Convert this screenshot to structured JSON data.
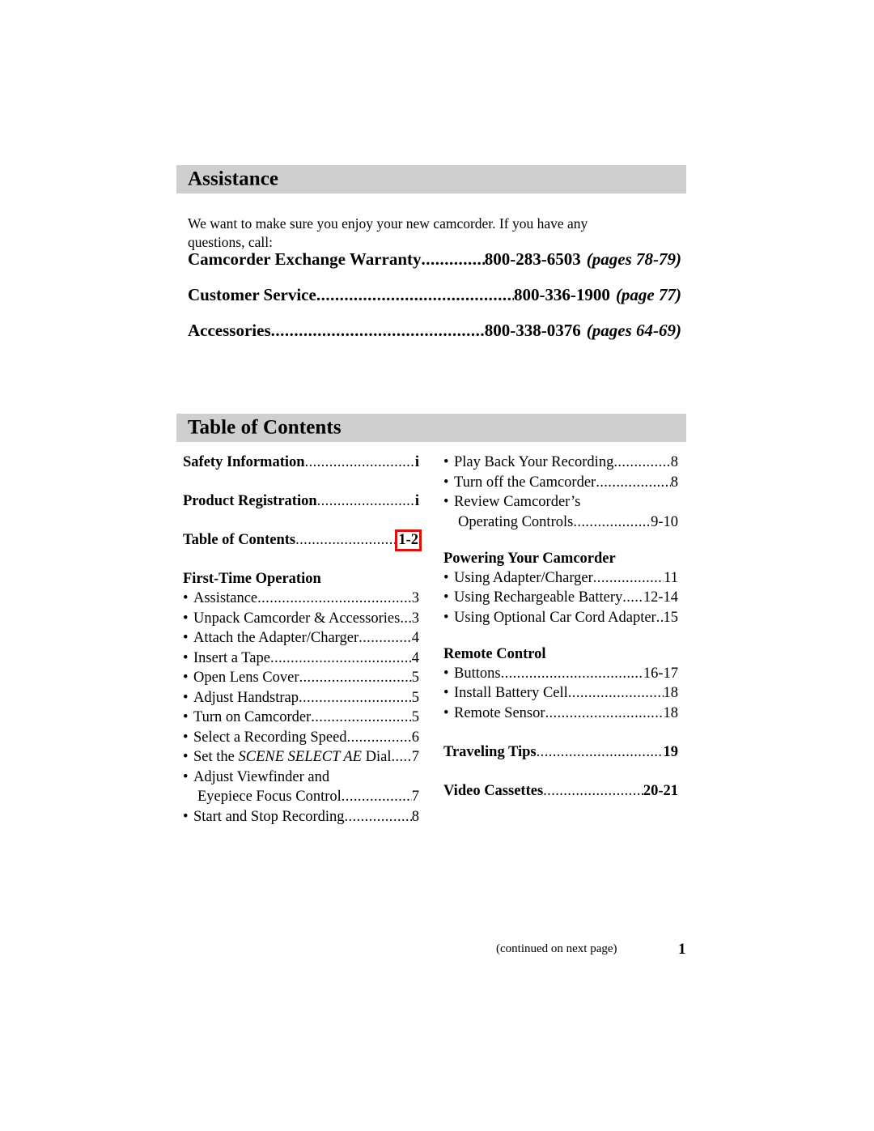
{
  "assistance": {
    "heading": "Assistance",
    "intro": "We want to make sure you enjoy your new camcorder. If you have any questions, call:",
    "contacts": [
      {
        "label": "Camcorder Exchange Warranty",
        "dots": "............................................................",
        "number": "800-283-6503",
        "pages": "(pages 78-79)"
      },
      {
        "label": "Customer Service",
        "dots": "............................................................",
        "number": "800-336-1900",
        "pages": "(page 77)"
      },
      {
        "label": "Accessories",
        "dots": "............................................................",
        "number": "800-338-0376",
        "pages": "(pages 64-69)"
      }
    ]
  },
  "toc": {
    "heading": "Table of Contents",
    "left_column": {
      "major_entries": [
        {
          "label": "Safety Information",
          "dots": "..........................................................",
          "page": "i",
          "highlighted": false
        },
        {
          "label": "Product Registration",
          "dots": "..........................................................",
          "page": "i",
          "highlighted": false
        },
        {
          "label": "Table of Contents",
          "dots": "..........................................................",
          "page": "1-2",
          "highlighted": true
        }
      ],
      "group_title": "First-Time Operation",
      "items": [
        {
          "bullet": "•",
          "label": "Assistance",
          "dots": "..................................................................",
          "page": "3",
          "continuation": false
        },
        {
          "bullet": "•",
          "label": "Unpack Camcorder & Accessories",
          "dots": "....",
          "page": "3",
          "continuation": false
        },
        {
          "bullet": "•",
          "label": "Attach the Adapter/Charger",
          "dots": "..................................................................",
          "page": "4",
          "continuation": false
        },
        {
          "bullet": "•",
          "label": "Insert a Tape",
          "dots": "..................................................................",
          "page": "4",
          "continuation": false
        },
        {
          "bullet": "•",
          "label": "Open Lens Cover",
          "dots": "..................................................................",
          "page": "5",
          "continuation": false
        },
        {
          "bullet": "•",
          "label": "Adjust Handstrap",
          "dots": "..................................................................",
          "page": "5",
          "continuation": false
        },
        {
          "bullet": "•",
          "label": "Turn on Camcorder",
          "dots": "..................................................................",
          "page": "5",
          "continuation": false
        },
        {
          "bullet": "•",
          "label": "Select a Recording Speed",
          "dots": "..................................................................",
          "page": "6",
          "continuation": false
        },
        {
          "bullet": "•",
          "label_pre": "Set the ",
          "label_em": "SCENE SELECT AE",
          "label_post": " Dial",
          "dots": "......",
          "page": "7",
          "continuation": false
        },
        {
          "bullet": "•",
          "label": "Adjust Viewfinder and",
          "dots": "",
          "page": "",
          "continuation": false
        },
        {
          "bullet": "•",
          "label": "Eyepiece Focus Control",
          "dots": "..................................................................",
          "page": "7",
          "continuation": true
        },
        {
          "bullet": "•",
          "label": "Start and Stop Recording",
          "dots": "..................................................................",
          "page": "8",
          "continuation": false
        }
      ]
    },
    "right_column": {
      "items_top": [
        {
          "bullet": "•",
          "label": "Play Back Your Recording",
          "dots": "..................................................................",
          "page": "8",
          "continuation": false
        },
        {
          "bullet": "•",
          "label": "Turn off the Camcorder",
          "dots": "..................................................................",
          "page": "8",
          "continuation": false
        },
        {
          "bullet": "•",
          "label": "Review Camcorder’s",
          "dots": "",
          "page": "",
          "continuation": false
        },
        {
          "bullet": "•",
          "label": "Operating Controls",
          "dots": "..................................................................",
          "page": "9-10",
          "continuation": true
        }
      ],
      "group_powering": {
        "title": "Powering Your Camcorder",
        "items": [
          {
            "bullet": "•",
            "label": "Using Adapter/Charger",
            "dots": "..................................................................",
            "page": "11",
            "continuation": false
          },
          {
            "bullet": "•",
            "label": "Using Rechargeable Battery",
            "dots": ".......",
            "page": "12-14",
            "continuation": false
          },
          {
            "bullet": "•",
            "label": "Using Optional Car Cord Adapter",
            "dots": "...",
            "page": "15",
            "continuation": false
          }
        ]
      },
      "group_remote": {
        "title": "Remote Control",
        "items": [
          {
            "bullet": "•",
            "label": "Buttons",
            "dots": "..................................................................",
            "page": "16-17",
            "continuation": false
          },
          {
            "bullet": "•",
            "label": "Install Battery Cell",
            "dots": "..................................................................",
            "page": "18",
            "continuation": false
          },
          {
            "bullet": "•",
            "label": "Remote Sensor",
            "dots": "..................................................................",
            "page": "18",
            "continuation": false
          }
        ]
      },
      "major_entries": [
        {
          "label": "Traveling Tips",
          "dots": "..........................................................",
          "page": "19",
          "highlighted": false
        },
        {
          "label": "Video Cassettes",
          "dots": "..........................................................",
          "page": "20-21",
          "highlighted": false
        }
      ]
    }
  },
  "footer": {
    "note": "(continued on next page)",
    "page_number": "1"
  },
  "colors": {
    "section_bar": "#cfcfcf",
    "highlight_outline": "#ff0000",
    "text": "#000000",
    "background": "#ffffff"
  }
}
